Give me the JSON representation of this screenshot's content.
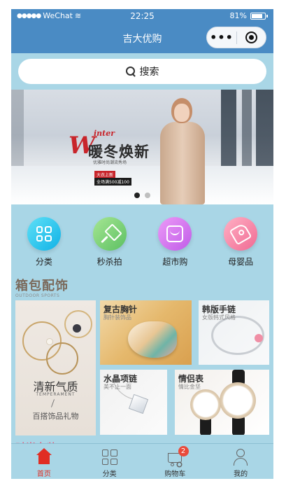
{
  "status_bar": {
    "carrier": "WeChat",
    "time": "22:25",
    "battery": "81%"
  },
  "nav": {
    "title": "吉大优购"
  },
  "search": {
    "label": "搜索"
  },
  "banner": {
    "big_letter": "W",
    "small_word": "inter",
    "title": "暖冬焕新",
    "subtitle": "优雅时尚潮流秀场",
    "tag_new": "大衣上新",
    "tag_deal": "全场满500减100",
    "slide_count": 2,
    "active_slide": 0
  },
  "categories": [
    {
      "label": "分类",
      "icon": "grid-icon",
      "color": "#29c4ec"
    },
    {
      "label": "秒杀拍",
      "icon": "hammer-icon",
      "color": "#7ed07a"
    },
    {
      "label": "超市购",
      "icon": "shop-icon",
      "color": "#d67df0"
    },
    {
      "label": "母婴品",
      "icon": "tag-icon",
      "color": "#f788a6"
    }
  ],
  "section": {
    "title": "箱包配饰",
    "subtitle": "OUTDOOR SPORTS"
  },
  "featured": {
    "title": "清新气质",
    "en": "TEMPERAMENT",
    "sub": "百搭饰品礼物"
  },
  "products": [
    {
      "title": "复古胸针",
      "desc": "胸针装饰品"
    },
    {
      "title": "韩版手链",
      "desc": "女版韩式风格"
    },
    {
      "title": "水晶项链",
      "desc": "美不止一面"
    },
    {
      "title": "情侣表",
      "desc": "情比金坚"
    }
  ],
  "next_section": "时尚女装",
  "tabs": [
    {
      "label": "首页",
      "active": true
    },
    {
      "label": "分类",
      "active": false
    },
    {
      "label": "购物车",
      "active": false,
      "badge": "2"
    },
    {
      "label": "我的",
      "active": false
    }
  ]
}
